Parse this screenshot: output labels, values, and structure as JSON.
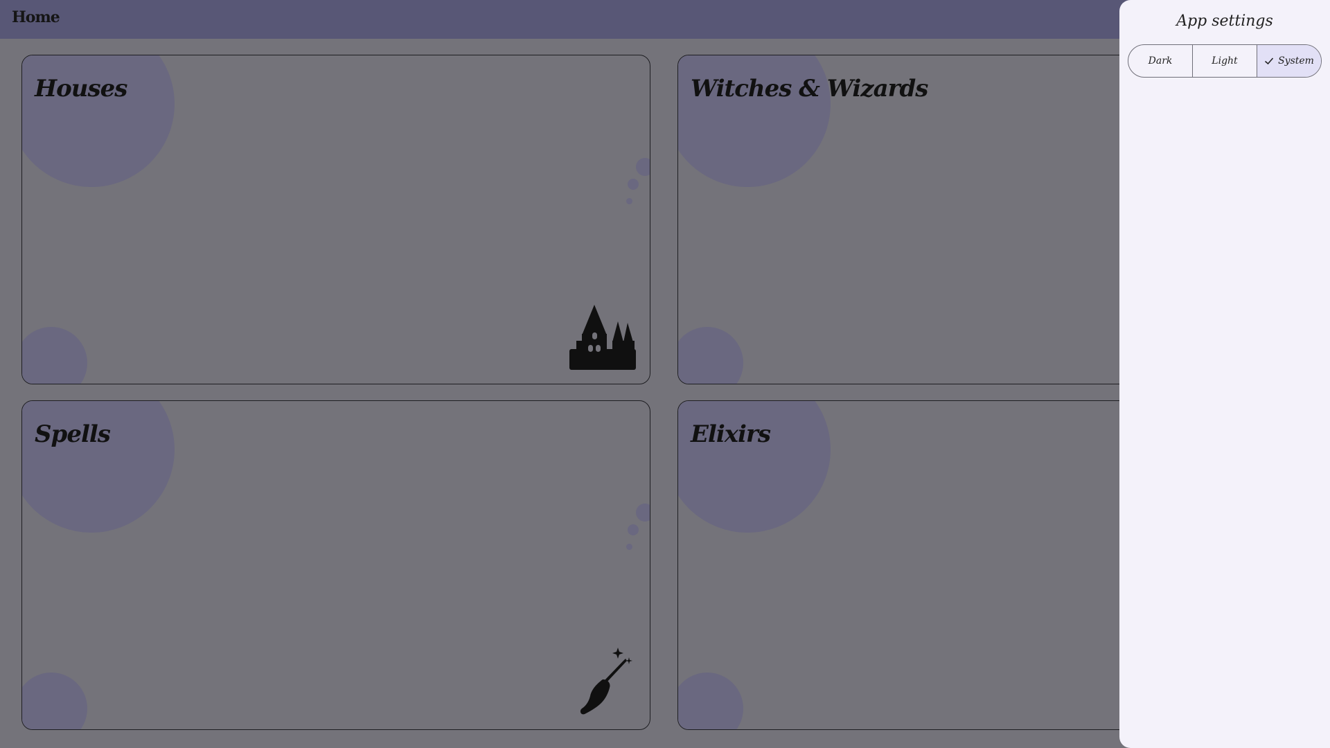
{
  "topbar": {
    "title": "Home",
    "color": "#585776"
  },
  "cards": [
    {
      "title": "Houses",
      "icon": "castle-icon"
    },
    {
      "title": "Witches & Wizards",
      "icon": ""
    },
    {
      "title": "Spells",
      "icon": "wand-icon"
    },
    {
      "title": "Elixirs",
      "icon": ""
    }
  ],
  "settings": {
    "title": "App settings",
    "theme_options": [
      "Dark",
      "Light",
      "System"
    ],
    "selected": "System"
  },
  "colors": {
    "scrim": "#74737a",
    "blob": "#6a6880",
    "panel": "#f4f2fa",
    "selected_segment": "#e2e0f6"
  }
}
